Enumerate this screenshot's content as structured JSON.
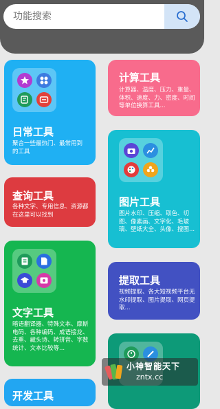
{
  "search": {
    "placeholder": "功能搜索",
    "button_icon": "search-icon"
  },
  "cards": {
    "daily": {
      "title": "日常工具",
      "desc": "聚合一些最热门、最常用到的工具",
      "color": "#1fb0f3",
      "icons": [
        "star-icon",
        "grid-icon",
        "timer-icon",
        "sync-icon"
      ]
    },
    "calc": {
      "title": "计算工具",
      "desc": "计算器、温度、压力、重量、体积、速度、力、密度、时间等单位换算工具...",
      "color": "#f86b8c"
    },
    "query": {
      "title": "查询工具",
      "desc": "各种文字、专用信息、资源都在这里可以找到",
      "color": "#dd3b40"
    },
    "image": {
      "title": "图片工具",
      "desc": "图片水印、压缩、取色、切图、像素画、文字化、毛玻璃、壁纸大全、头像、搜图...",
      "color": "#17bfd2",
      "icons": [
        "camera-icon",
        "chart-icon",
        "palette-icon",
        "flower-icon"
      ]
    },
    "text": {
      "title": "文字工具",
      "desc": "暗语翻译器、特殊文本、摩斯电码、各种编码、成语接龙、去重、藏头诗、转拼音、字数统计、文本比较等...",
      "color": "#15b650",
      "icons": [
        "document-icon",
        "file-icon",
        "graduation-cap-icon",
        "album-icon"
      ]
    },
    "extract": {
      "title": "提取工具",
      "desc": "视频提取、各大短视频平台无水印提取、图片提取、网页提取...",
      "color": "#4251c2"
    },
    "dev": {
      "title": "开发工具",
      "color": "#22a6f2"
    },
    "partial": {
      "color": "#0d9a78",
      "icons": [
        "clock-icon",
        "pencil-icon"
      ]
    }
  },
  "watermark": {
    "title": "小神智能天下",
    "url": "zntx.cc"
  }
}
